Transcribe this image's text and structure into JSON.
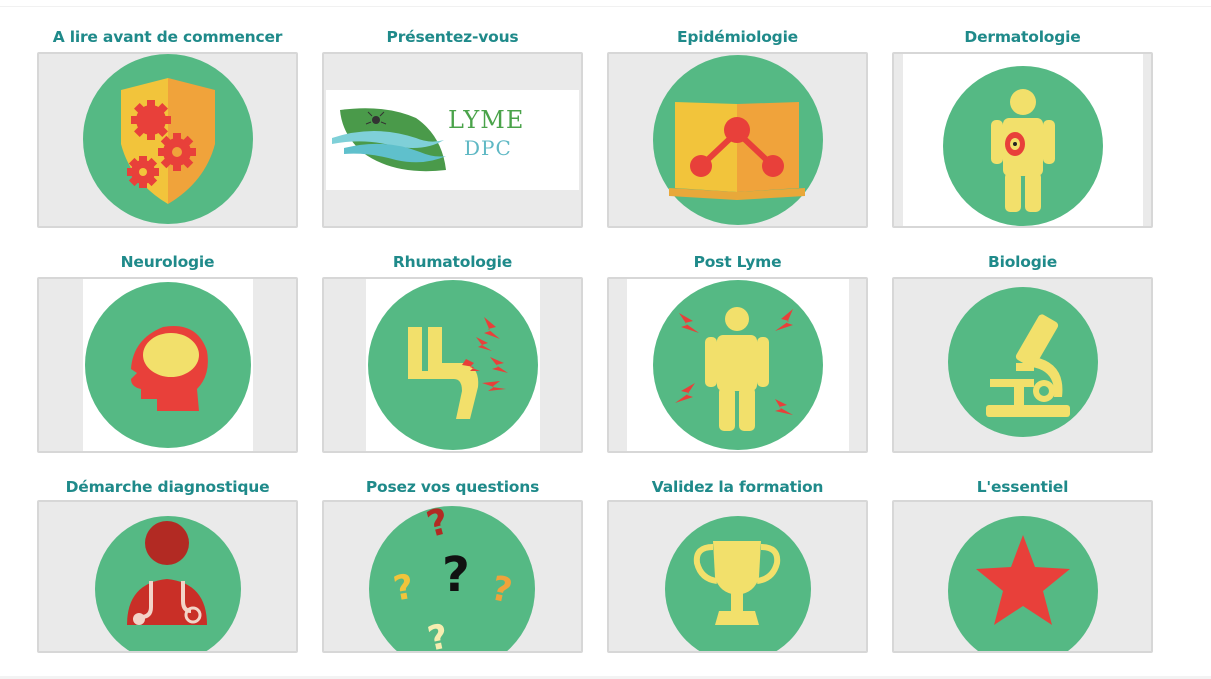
{
  "cards": [
    {
      "title": "A lire avant de commencer",
      "icon": "shield-gears-icon"
    },
    {
      "title": "Présentez-vous",
      "icon": "lyme-dpc-logo"
    },
    {
      "title": "Epidémiologie",
      "icon": "book-molecule-icon"
    },
    {
      "title": "Dermatologie",
      "icon": "body-rash-icon"
    },
    {
      "title": "Neurologie",
      "icon": "head-brain-icon"
    },
    {
      "title": "Rhumatologie",
      "icon": "joint-pain-icon"
    },
    {
      "title": "Post Lyme",
      "icon": "body-pain-icon"
    },
    {
      "title": "Biologie",
      "icon": "microscope-icon"
    },
    {
      "title": "Démarche diagnostique",
      "icon": "doctor-stethoscope-icon"
    },
    {
      "title": "Posez vos questions",
      "icon": "question-marks-icon"
    },
    {
      "title": "Validez la formation",
      "icon": "trophy-icon"
    },
    {
      "title": "L'essentiel",
      "icon": "star-icon"
    }
  ],
  "logo": {
    "text_top": "LYME",
    "text_bottom": "DPC"
  },
  "colors": {
    "title": "#1f8a8a",
    "circle": "#55b984",
    "tile_bg": "#eaeaea",
    "tile_border": "#d7d7d7"
  }
}
